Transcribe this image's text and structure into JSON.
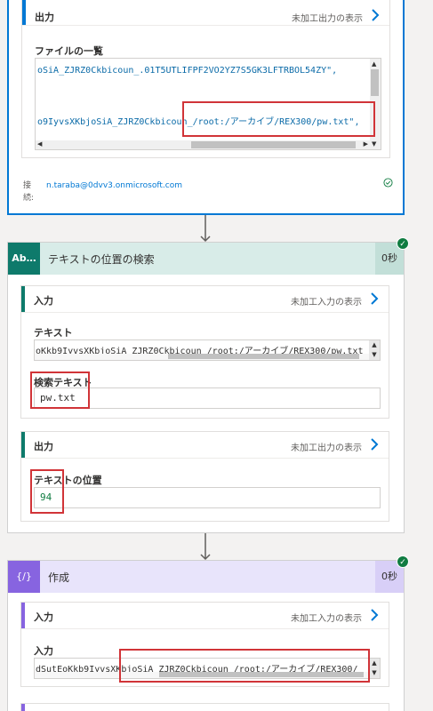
{
  "card1": {
    "output": {
      "title": "出力",
      "raw_link": "未加工出力の表示",
      "field_label": "ファイルの一覧",
      "line1": "oSiA_ZJRZ0Ckbicoun_.01T5UTLIFPF2VO2YZ7S5GK3LFTRBOL54ZY\",",
      "line2": "o9IyvsXKbjoSiA_ZJRZ0Ckbicoun_/root:/アーカイブ/REX300/pw.txt\","
    },
    "connection": {
      "label": "接続:",
      "account": "n.taraba@0dvv3.onmicrosoft.com"
    }
  },
  "card2": {
    "icon_text": "Ab…",
    "title": "テキストの位置の検索",
    "duration": "0秒",
    "input": {
      "title": "入力",
      "raw_link": "未加工入力の表示",
      "text_label": "テキスト",
      "text_value": "oKkb9IyvsXKbjoSiA_ZJRZ0Ckbicoun_/root:/アーカイブ/REX300/pw.txt",
      "search_label": "検索テキスト",
      "search_value": "pw.txt"
    },
    "output": {
      "title": "出力",
      "raw_link": "未加工出力の表示",
      "position_label": "テキストの位置",
      "position_value": "94"
    }
  },
  "card3": {
    "icon_text": "{∕}",
    "title": "作成",
    "duration": "0秒",
    "input": {
      "title": "入力",
      "raw_link": "未加工入力の表示",
      "field_label": "入力",
      "value": "dSutEoKkb9IyvsXKbjoSiA_ZJRZ0Ckbicoun_/root:/アーカイブ/REX300/"
    }
  },
  "colors": {
    "accent": "#0078d4",
    "text_action": "#d8ece8",
    "text_action_icon": "#0e7a6b",
    "compose_action": "#e8e4fb",
    "compose_icon": "#8764e0",
    "highlight": "#d13438",
    "success": "#107c41"
  }
}
